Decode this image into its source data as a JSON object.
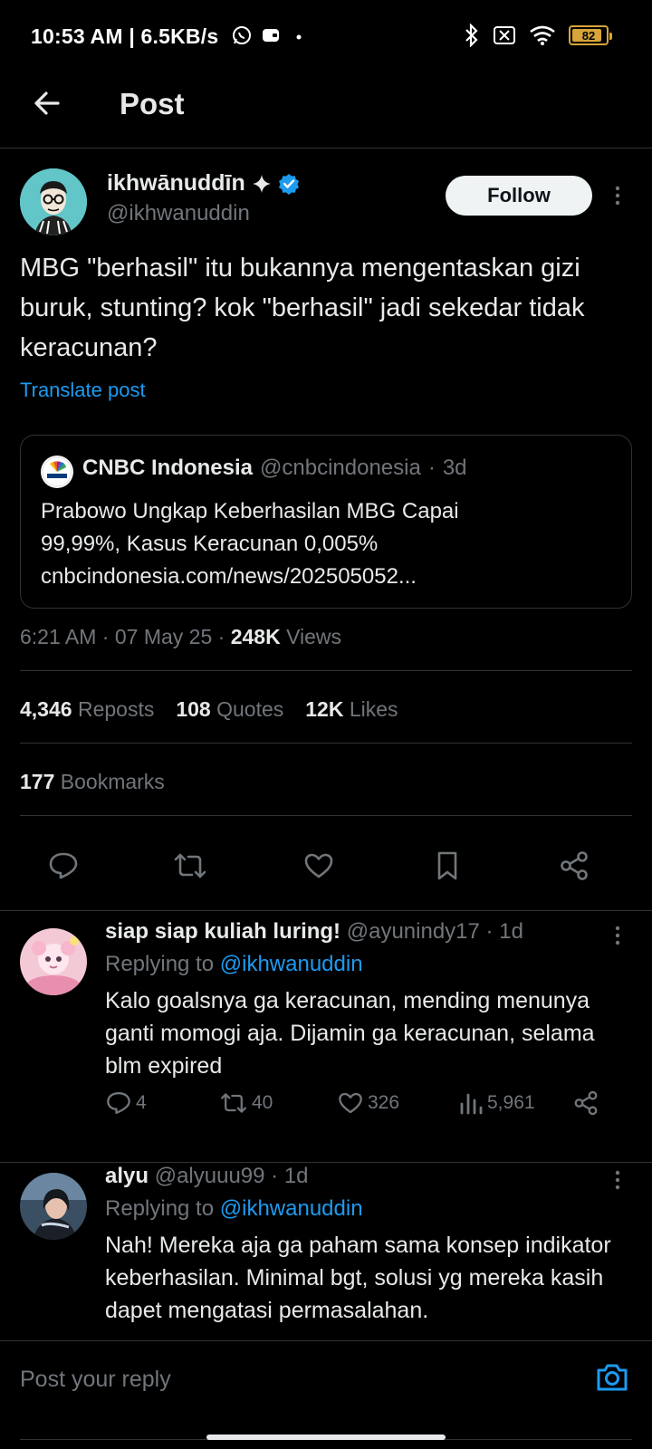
{
  "status_bar": {
    "time": "10:53 AM | 6.5KB/s",
    "battery": "82"
  },
  "header": {
    "title": "Post"
  },
  "post": {
    "author_name": "ikhwānuddīn",
    "author_handle": "@ikhwanuddin",
    "follow_label": "Follow",
    "text": "MBG \"berhasil\" itu bukannya mengentaskan gizi buruk, stunting? kok \"berhasil\" jadi sekedar tidak keracunan?",
    "translate_label": "Translate post",
    "quote": {
      "source_name": "CNBC Indonesia",
      "source_handle": "@cnbcindonesia",
      "age": "3d",
      "line1": "Prabowo Ungkap Keberhasilan MBG Capai",
      "line2": "99,99%, Kasus Keracunan 0,005%",
      "line3": "cnbcindonesia.com/news/202505052..."
    },
    "time": "6:21 AM",
    "date": "07 May 25",
    "views_count": "248K",
    "views_label": "Views",
    "reposts_count": "4,346",
    "reposts_label": "Reposts",
    "quotes_count": "108",
    "quotes_label": "Quotes",
    "likes_count": "12K",
    "likes_label": "Likes",
    "bookmarks_count": "177",
    "bookmarks_label": "Bookmarks"
  },
  "replies": [
    {
      "name": "siap siap kuliah luring!",
      "handle": "@ayunindy17",
      "age": "1d",
      "replying_prefix": "Replying to",
      "replying_to": "@ikhwanuddin",
      "text": "Kalo goalsnya ga keracunan, mending menunya ganti momogi aja. Dijamin ga keracunan, selama blm expired",
      "replies": "4",
      "reposts": "40",
      "likes": "326",
      "views": "5,961"
    },
    {
      "name": "alyu",
      "handle": "@alyuuu99",
      "age": "1d",
      "replying_prefix": "Replying to",
      "replying_to": "@ikhwanuddin",
      "text": "Nah! Mereka aja ga paham sama konsep indikator keberhasilan. Minimal bgt, solusi yg mereka kasih dapet mengatasi permasalahan."
    }
  ],
  "composer": {
    "placeholder": "Post your reply"
  },
  "colors": {
    "accent": "#1d9bf0",
    "background": "#000000",
    "text": "#e7e9ea",
    "muted": "#71767b",
    "battery": "#d8a53a"
  }
}
